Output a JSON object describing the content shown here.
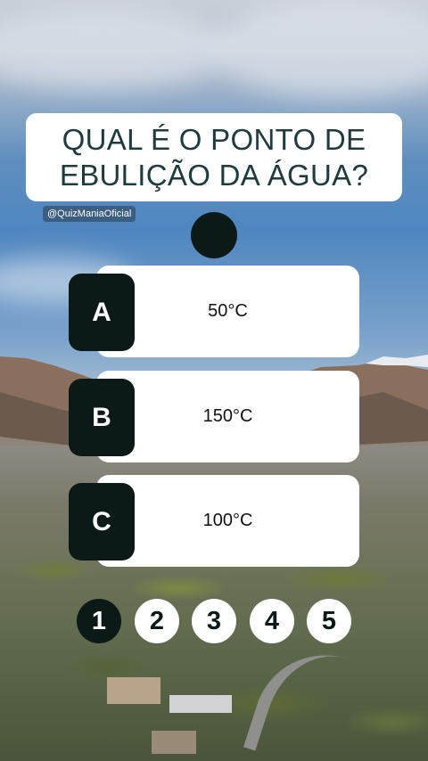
{
  "question": {
    "text": "QUAL É O PONTO DE\nEBULIÇÃO DA ÁGUA?"
  },
  "handle": "@QuizManiaOficial",
  "answers": [
    {
      "letter": "A",
      "text": "50°C"
    },
    {
      "letter": "B",
      "text": "150°C"
    },
    {
      "letter": "C",
      "text": "100°C"
    }
  ],
  "pagination": {
    "pages": [
      "1",
      "2",
      "3",
      "4",
      "5"
    ],
    "active": "1"
  },
  "colors": {
    "dark_accent": "#0c1a17",
    "card": "#ffffff",
    "question_text": "#1f3b3b"
  }
}
